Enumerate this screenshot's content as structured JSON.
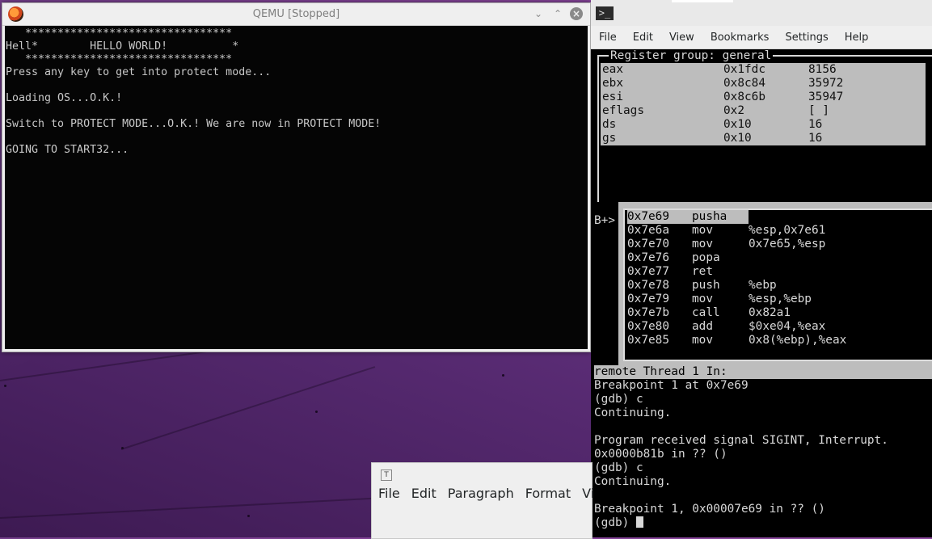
{
  "qemu": {
    "title": "QEMU [Stopped]",
    "screen_lines": [
      "   ********************************",
      "Hell*        HELLO WORLD!          *",
      "   ********************************",
      "Press any key to get into protect mode...",
      "",
      "Loading OS...O.K.!",
      "",
      "Switch to PROTECT MODE...O.K.! We are now in PROTECT MODE!",
      "",
      "GOING TO START32..."
    ]
  },
  "terminal": {
    "menu": [
      "File",
      "Edit",
      "View",
      "Bookmarks",
      "Settings",
      "Help"
    ],
    "register_group_label": "Register group: general",
    "registers": [
      {
        "name": "eax",
        "hex": "0x1fdc",
        "dec": "8156"
      },
      {
        "name": "ebx",
        "hex": "0x8c84",
        "dec": "35972"
      },
      {
        "name": "esi",
        "hex": "0x8c6b",
        "dec": "35947"
      },
      {
        "name": "eflags",
        "hex": "0x2",
        "dec": "[ ]"
      },
      {
        "name": "ds",
        "hex": "0x10",
        "dec": "16"
      },
      {
        "name": "gs",
        "hex": "0x10",
        "dec": "16"
      }
    ],
    "breakpoint_marker": "B+>",
    "asm": [
      {
        "addr": "0x7e69",
        "op": "pusha",
        "args": ""
      },
      {
        "addr": "0x7e6a",
        "op": "mov",
        "args": "%esp,0x7e61"
      },
      {
        "addr": "0x7e70",
        "op": "mov",
        "args": "0x7e65,%esp"
      },
      {
        "addr": "0x7e76",
        "op": "popa",
        "args": ""
      },
      {
        "addr": "0x7e77",
        "op": "ret",
        "args": ""
      },
      {
        "addr": "0x7e78",
        "op": "push",
        "args": "%ebp"
      },
      {
        "addr": "0x7e79",
        "op": "mov",
        "args": "%esp,%ebp"
      },
      {
        "addr": "0x7e7b",
        "op": "call",
        "args": "0x82a1"
      },
      {
        "addr": "0x7e80",
        "op": "add",
        "args": "$0xe04,%eax"
      },
      {
        "addr": "0x7e85",
        "op": "mov",
        "args": "0x8(%ebp),%eax"
      }
    ],
    "status_line": "remote Thread 1 In:",
    "console_lines": [
      "Breakpoint 1 at 0x7e69",
      "(gdb) c",
      "Continuing.",
      "",
      "Program received signal SIGINT, Interrupt.",
      "0x0000b81b in ?? ()",
      "(gdb) c",
      "Continuing.",
      "",
      "Breakpoint 1, 0x00007e69 in ?? ()"
    ],
    "prompt": "(gdb) "
  },
  "editor": {
    "icon": "T",
    "menu": [
      "File",
      "Edit",
      "Paragraph",
      "Format",
      "Vi"
    ]
  }
}
